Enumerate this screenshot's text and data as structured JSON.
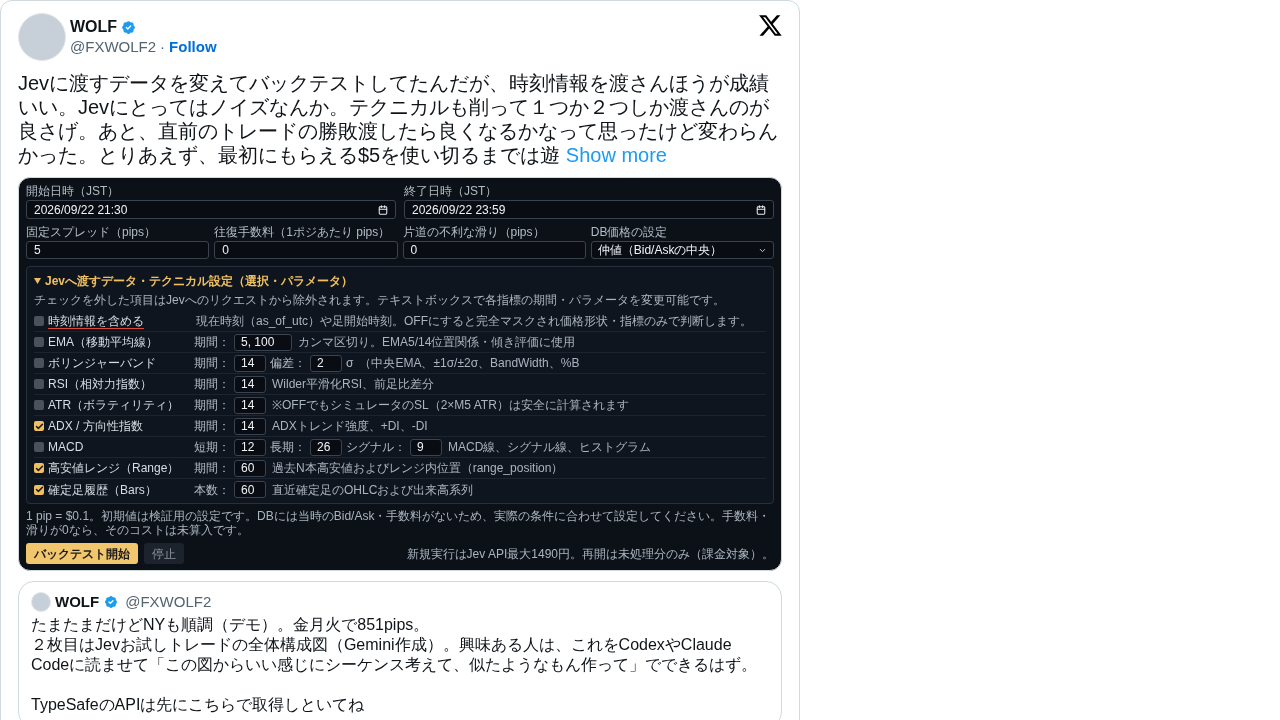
{
  "tweet": {
    "author": {
      "name": "WOLF",
      "verified": true,
      "handle": "@FXWOLF2"
    },
    "separator": "·",
    "follow": "Follow",
    "text": "Jevに渡すデータを変えてバックテストしてたんだが、時刻情報を渡さんほうが成績いい。Jevにとってはノイズなんか。テクニカルも削って１つか２つしか渡さんのが良さげ。あと、直前のトレードの勝敗渡したら良くなるかなって思ったけど変わらんかった。とりあえず、最初にもらえる$5を使い切るまでは遊",
    "show_more": "Show more"
  },
  "attached_screenshot": {
    "date_fields": [
      {
        "label": "開始日時（JST）",
        "value": "2026/09/22 21:30"
      },
      {
        "label": "終了日時（JST）",
        "value": "2026/09/22 23:59"
      }
    ],
    "cost_fields": [
      {
        "kind": "input",
        "label": "固定スプレッド（pips）",
        "value": "5"
      },
      {
        "kind": "input",
        "label": "往復手数料（1ポジあたり pips）",
        "value": "0"
      },
      {
        "kind": "input",
        "label": "片道の不利な滑り（pips）",
        "value": "0"
      },
      {
        "kind": "select",
        "label": "DB価格の設定",
        "value": "仲値（Bid/Askの中央）"
      }
    ],
    "data_panel": {
      "expanded": true,
      "title": "Jevへ渡すデータ・テクニカル設定（選択・パラメータ）",
      "note": "チェックを外した項目はJevへのリクエストから除外されます。テキストボックスで各指標の期間・パラメータを変更可能です。",
      "rows": [
        {
          "label": "時刻情報を含める",
          "checked": false,
          "underlined": true,
          "params": [],
          "description": "現在時刻（as_of_utc）や足開始時刻。OFFにすると完全マスクされ価格形状・指標のみで判断します。"
        },
        {
          "label": "EMA（移動平均線）",
          "checked": false,
          "underlined": false,
          "params": [
            {
              "label": "期間：",
              "value": "5, 100"
            }
          ],
          "description": "カンマ区切り。EMA5/14位置関係・傾き評価に使用"
        },
        {
          "label": "ボリンジャーバンド",
          "checked": false,
          "underlined": false,
          "params": [
            {
              "label": "期間：",
              "value": "14"
            },
            {
              "label": "偏差：",
              "value": "2",
              "unit": "σ"
            }
          ],
          "description": "（中央EMA、±1σ/±2σ、BandWidth、%B"
        },
        {
          "label": "RSI（相対力指数）",
          "checked": false,
          "underlined": false,
          "params": [
            {
              "label": "期間：",
              "value": "14"
            }
          ],
          "description": "Wilder平滑化RSI、前足比差分"
        },
        {
          "label": "ATR（ボラティリティ）",
          "checked": false,
          "underlined": false,
          "params": [
            {
              "label": "期間：",
              "value": "14"
            }
          ],
          "description": "※OFFでもシミュレータのSL（2×M5 ATR）は安全に計算されます"
        },
        {
          "label": "ADX / 方向性指数",
          "checked": true,
          "underlined": false,
          "params": [
            {
              "label": "期間：",
              "value": "14"
            }
          ],
          "description": "ADXトレンド強度、+DI、-DI"
        },
        {
          "label": "MACD",
          "checked": false,
          "underlined": false,
          "params": [
            {
              "label": "短期：",
              "value": "12"
            },
            {
              "label": "長期：",
              "value": "26"
            },
            {
              "label": "シグナル：",
              "value": "9"
            }
          ],
          "description": "MACD線、シグナル線、ヒストグラム"
        },
        {
          "label": "高安値レンジ（Range）",
          "checked": true,
          "underlined": false,
          "params": [
            {
              "label": "期間：",
              "value": "60"
            }
          ],
          "description": "過去N本高安値およびレンジ内位置（range_position）"
        },
        {
          "label": "確定足履歴（Bars）",
          "checked": true,
          "underlined": false,
          "params": [
            {
              "label": "本数：",
              "value": "60"
            }
          ],
          "description": "直近確定足のOHLCおよび出来高系列"
        }
      ]
    },
    "footnote": "1 pip = $0.1。初期値は検証用の設定です。DBには当時のBid/Ask・手数料がないため、実際の条件に合わせて設定してください。手数料・滑りが0なら、そのコストは未算入です。",
    "buttons": [
      {
        "label": "バックテスト開始",
        "disabled": false
      },
      {
        "label": "停止",
        "disabled": true
      }
    ],
    "cost_note": "新規実行はJev API最大1490円。再開は未処理分のみ（課金対象）。"
  },
  "quoted_tweet": {
    "author": {
      "name": "WOLF",
      "verified": true,
      "handle": "@FXWOLF2"
    },
    "blocks": [
      {
        "lines": [
          "たまたまだけどNYも順調（デモ）。金月火で851pips。",
          "２枚目はJevお試しトレードの全体構成図（Gemini作成）。興味ある人は、これをCodexやClaude Codeに読ませて「この図からいい感じにシーケンス考えて、似たようなもん作って」でできるはず。"
        ]
      },
      {
        "lines": [
          "TypeSafeのAPIは先にこちらで取得しといてね"
        ]
      }
    ]
  }
}
